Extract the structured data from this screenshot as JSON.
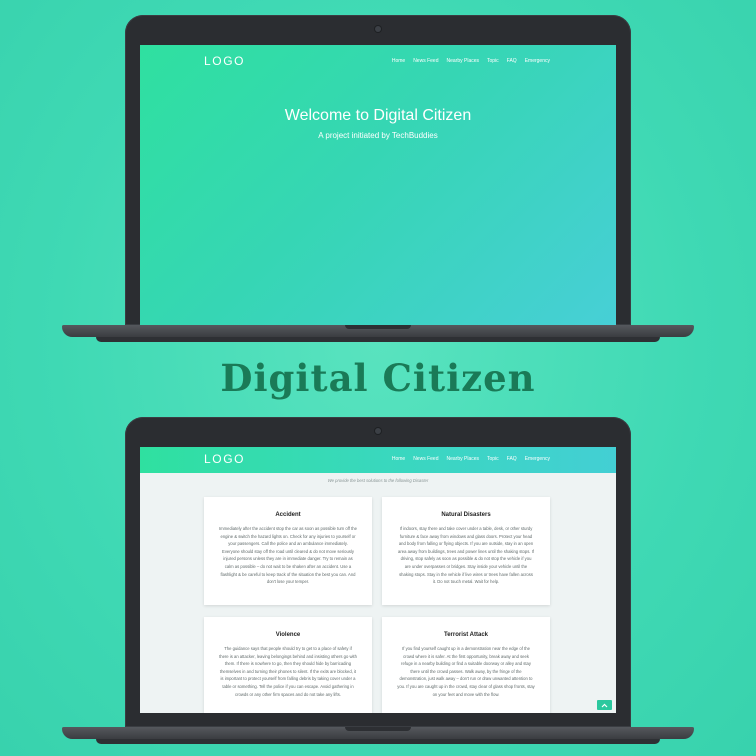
{
  "title": "Digital Citizen",
  "site": {
    "logo": "LOGO",
    "nav": [
      "Home",
      "News Feed",
      "Nearby Places",
      "Topic",
      "FAQ",
      "Emergency"
    ]
  },
  "hero": {
    "title": "Welcome to Digital Citizen",
    "subtitle": "A project initiated by TechBuddies"
  },
  "content": {
    "tagline": "We provide the best solutions to the following Disaster",
    "cards": [
      {
        "title": "Accident",
        "body": "Immediately after the accident stop the car as soon as possible turn off the engine & switch the hazard lights on. Check for any injuries to yourself or your passengers. Call the police and an ambulance immediately. Everyone should stay off the road until cleared & do not move seriously injured persons unless they are in immediate danger. Try to remain as calm as possible – do not wait to be shaken after an accident. Use a flashlight & be careful to keep track of the situation the best you can. And don't lose your temper."
      },
      {
        "title": "Natural Disasters",
        "body": "If indoors, stay there and take cover under a table, desk, or other sturdy furniture & face away from windows and glass doors. Protect your head and body from falling or flying objects. If you are outside, stay in an open area away from buildings, trees and power lines until the shaking stops. If driving, stop safely as soon as possible & do not stop the vehicle if you are under overpasses or bridges. Stay inside your vehicle until the shaking stops. Stay in the vehicle if live wires or trees have fallen across it. Do not touch metal. Wait for help."
      },
      {
        "title": "Violence",
        "body": "The guidance says that people should try to get to a place of safety if there is an attacker, leaving belongings behind and insisting others go with them. If there is nowhere to go, then they should hide by barricading themselves in and turning their phones to silent. If the exits are blocked, it is important to protect yourself from falling debris by taking cover under a table or something. Tell the police if you can escape. Avoid gathering in crowds or any other firm spaces and do not take any lifts."
      },
      {
        "title": "Terrorist Attack",
        "body": "If you find yourself caught up in a demonstration near the edge of the crowd where it is safer. At the first opportunity, break away and seek refuge in a nearby building or find a suitable doorway or alley and stay there until the crowd passes. Walk away, by the fringe of the demonstration, just walk away – don't run or draw unwanted attention to you. If you are caught up in the crowd, stay clear of glass shop fronts, stay on your feet and move with the flow."
      }
    ]
  },
  "icons": {
    "scroll_top": "chevron-up-icon"
  },
  "colors": {
    "accent": "#2fe0a0",
    "title": "#1a7a57",
    "background": "#3fd9b4"
  }
}
